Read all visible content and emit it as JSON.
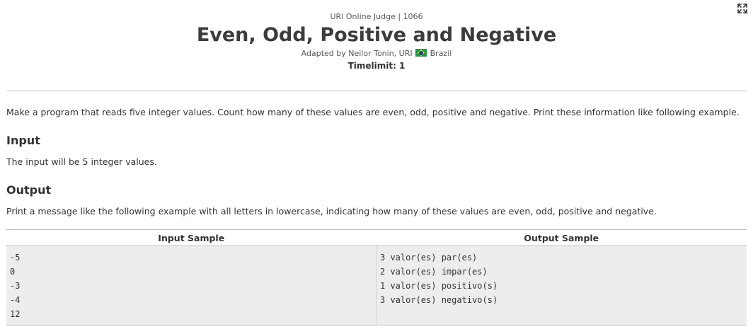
{
  "header": {
    "judge_line": "URI Online Judge | 1066",
    "title": "Even, Odd, Positive and Negative",
    "adapted_prefix": "Adapted by Neilor Tonin, URI",
    "adapted_country": "Brazil",
    "timelimit": "Timelimit: 1"
  },
  "description": "Make a program that reads five integer values. Count how many   of these values are even, odd, positive and negative. Print these information like following example.",
  "input_section": {
    "heading": "Input",
    "text": "The input will be 5 integer values."
  },
  "output_section": {
    "heading": "Output",
    "text": "Print a message like the following example with all letters in lowercase, indicating how many of these values are even, odd, positive and negative."
  },
  "samples": {
    "input_header": "Input Sample",
    "output_header": "Output Sample",
    "input_lines": [
      "-5",
      "0",
      "-3",
      "-4",
      "12"
    ],
    "output_lines": [
      "3 valor(es) par(es)",
      "2 valor(es) impar(es)",
      "1 valor(es) positivo(s)",
      "3 valor(es) negativo(s)"
    ]
  },
  "icons": {
    "fullscreen": "expand-arrows-icon",
    "flag": "brazil-flag-icon"
  },
  "colors": {
    "sample_background": "#ededed",
    "divider": "#c8c8c8",
    "flag_green": "#1e9a3a",
    "flag_yellow": "#f7d417",
    "flag_blue": "#1f3f8f"
  }
}
